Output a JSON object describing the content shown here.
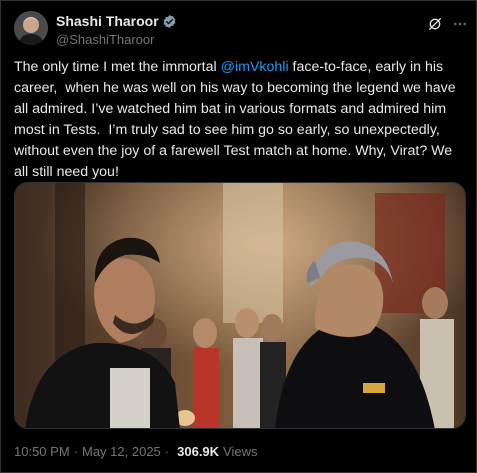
{
  "author": {
    "display_name": "Shashi Tharoor",
    "handle": "@ShashiTharoor",
    "verified": true
  },
  "header_actions": [
    {
      "icon": "grok-icon"
    },
    {
      "icon": "more-icon",
      "label": "···"
    }
  ],
  "tweet": {
    "text_before": "The only time I met the immortal ",
    "mention": "@imVkohli",
    "text_after": " face-to-face, early in his career,  when he was well on his way to becoming the legend we have all admired. I’ve watched him bat in various formats and admired him most in Tests.  I’m truly sad to see him go so early, so unexpectedly, without even the joy of a farewell Test match at home. Why, Virat? We all still need you!"
  },
  "meta": {
    "time": "10:50 PM",
    "separator": "·",
    "date": "May 12, 2025",
    "views_count": "306.9K",
    "views_label": "Views"
  },
  "colors": {
    "background": "#000000",
    "text": "#e7e9ea",
    "secondary": "#71767b",
    "accent": "#1d9bf0",
    "border": "#2f3336"
  }
}
